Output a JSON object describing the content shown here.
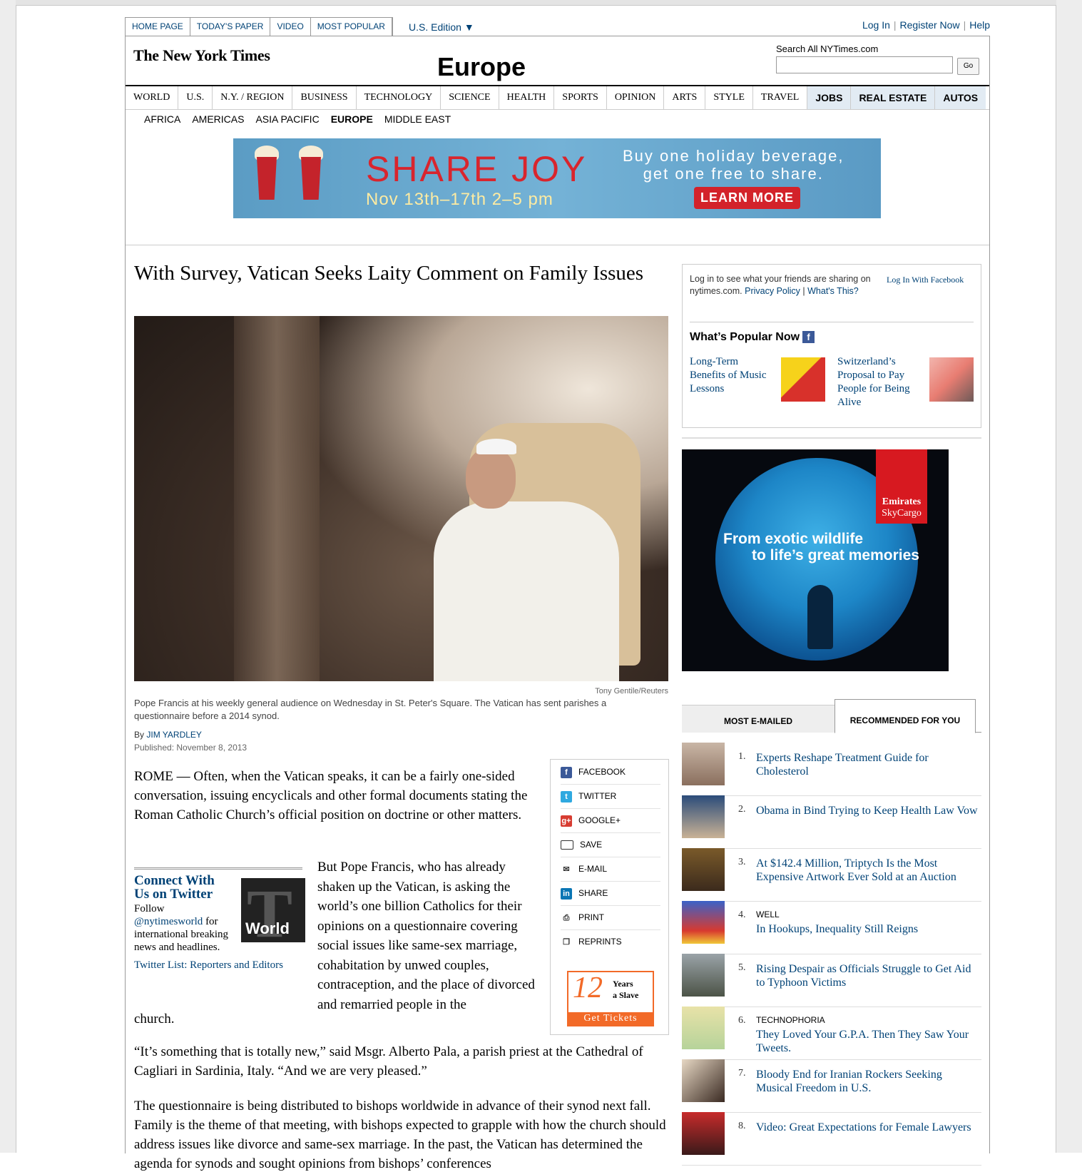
{
  "top_nav": [
    "HOME PAGE",
    "TODAY'S PAPER",
    "VIDEO",
    "MOST POPULAR"
  ],
  "edition": "U.S. Edition ▼",
  "top_links": {
    "login": "Log In",
    "register": "Register Now",
    "help": "Help"
  },
  "logo_text": "The New York Times",
  "section_title": "Europe",
  "search": {
    "label": "Search All NYTimes.com",
    "go": "Go",
    "value": ""
  },
  "sections": [
    "WORLD",
    "U.S.",
    "N.Y. / REGION",
    "BUSINESS",
    "TECHNOLOGY",
    "SCIENCE",
    "HEALTH",
    "SPORTS",
    "OPINION",
    "ARTS",
    "STYLE",
    "TRAVEL"
  ],
  "classifieds": [
    "JOBS",
    "REAL ESTATE",
    "AUTOS"
  ],
  "subsections": [
    "AFRICA",
    "AMERICAS",
    "ASIA PACIFIC",
    "EUROPE",
    "MIDDLE EAST"
  ],
  "current_subsection": "EUROPE",
  "banner_ad": {
    "headline": "SHARE JOY",
    "dates": "Nov 13th–17th  2–5 pm",
    "offer_line1": "Buy one holiday beverage,",
    "offer_line2": "get one free to share.",
    "cta": "LEARN MORE"
  },
  "article": {
    "headline": "With Survey, Vatican Seeks Laity Comment on Family Issues",
    "photo_credit": "Tony Gentile/Reuters",
    "caption": "Pope Francis at his weekly general audience on Wednesday in St. Peter's Square. The Vatican has sent parishes a questionnaire before a 2014 synod.",
    "byline_prefix": "By",
    "author": "JIM YARDLEY",
    "published": "Published: November 8, 2013",
    "p1": "ROME — Often, when the Vatican speaks, it can be a fairly one-sided conversation, issuing encyclicals and other formal documents stating the Roman Catholic Church’s official position on doctrine or other matters.",
    "p2": "But Pope Francis, who has already shaken up the Vatican, is asking the world’s one billion Catholics for their opinions on a questionnaire covering social issues like same-sex marriage, cohabitation by unwed couples, contraception, and the place of divorced and remarried people in the",
    "p2_end": "church.",
    "p3": "“It’s something that is totally new,” said Msgr. Alberto Pala, a parish priest at the Cathedral of Cagliari in Sardinia, Italy. “And we are very pleased.”",
    "p4": "The questionnaire is being distributed to bishops worldwide in advance of their synod next fall. Family is the theme of that meeting, with bishops expected to grapple with how the church should address issues like divorce and same-sex marriage. In the past, the Vatican has determined the agenda for synods and sought opinions from bishops’ conferences"
  },
  "connect": {
    "title": "Connect With Us on Twitter",
    "follow_prefix": "Follow",
    "handle": "@nytimesworld",
    "follow_suffix": "for international breaking news and headlines.",
    "twitter_list": "Twitter List: Reporters and Editors",
    "logo_label": "World"
  },
  "share_tools": [
    "FACEBOOK",
    "TWITTER",
    "GOOGLE+",
    "SAVE",
    "E-MAIL",
    "SHARE",
    "PRINT",
    "REPRINTS"
  ],
  "tickets_ad": {
    "number": "12",
    "title_line1": "Years",
    "title_line2": "a Slave",
    "cta": "Get Tickets"
  },
  "facebook": {
    "text": "Log in to see what your friends are sharing on nytimes.com.",
    "privacy": "Privacy Policy",
    "whats_this": "What's This?",
    "login": "Log In With Facebook",
    "popular_title": "What’s Popular Now"
  },
  "popular": [
    "Long-Term Benefits of Music Lessons",
    "Switzerland’s Proposal to Pay People for Being Alive"
  ],
  "emirates_ad": {
    "line1": "From exotic wildlife",
    "line2": "to life’s great memories",
    "brand": "Emirates",
    "sub": "SkyCargo"
  },
  "tabs": [
    "MOST E-MAILED",
    "RECOMMENDED FOR YOU"
  ],
  "recommended": [
    {
      "n": "1.",
      "kicker": "",
      "title": "Experts Reshape Treatment Guide for Cholesterol"
    },
    {
      "n": "2.",
      "kicker": "",
      "title": "Obama in Bind Trying to Keep Health Law Vow"
    },
    {
      "n": "3.",
      "kicker": "",
      "title": "At $142.4 Million, Triptych Is the Most Expensive Artwork Ever Sold at an Auction"
    },
    {
      "n": "4.",
      "kicker": "WELL",
      "title": "In Hookups, Inequality Still Reigns"
    },
    {
      "n": "5.",
      "kicker": "",
      "title": "Rising Despair as Officials Struggle to Get Aid to Typhoon Victims"
    },
    {
      "n": "6.",
      "kicker": "TECHNOPHORIA",
      "title": "They Loved Your G.P.A. Then They Saw Your Tweets."
    },
    {
      "n": "7.",
      "kicker": "",
      "title": "Bloody End for Iranian Rockers Seeking Musical Freedom in U.S."
    },
    {
      "n": "8.",
      "kicker": "",
      "title": "Video: Great Expectations for Female Lawyers"
    }
  ]
}
